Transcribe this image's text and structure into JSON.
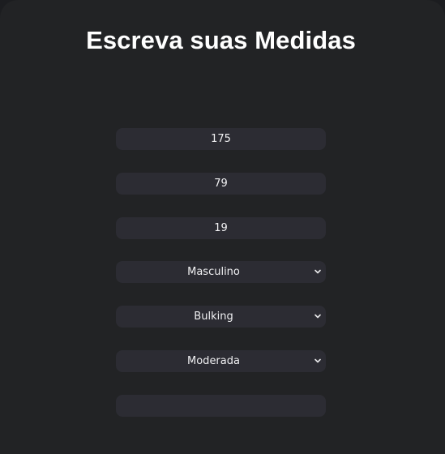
{
  "header": {
    "title": "Escreva suas Medidas"
  },
  "form": {
    "height": "175",
    "weight": "79",
    "age": "19",
    "sex": "Masculino",
    "goal": "Bulking",
    "activity": "Moderada",
    "extra": ""
  },
  "icons": {
    "chevron": "chevron-down-icon"
  },
  "colors": {
    "background": "#222325",
    "field": "#2c2c33",
    "text": "#ffffff"
  }
}
